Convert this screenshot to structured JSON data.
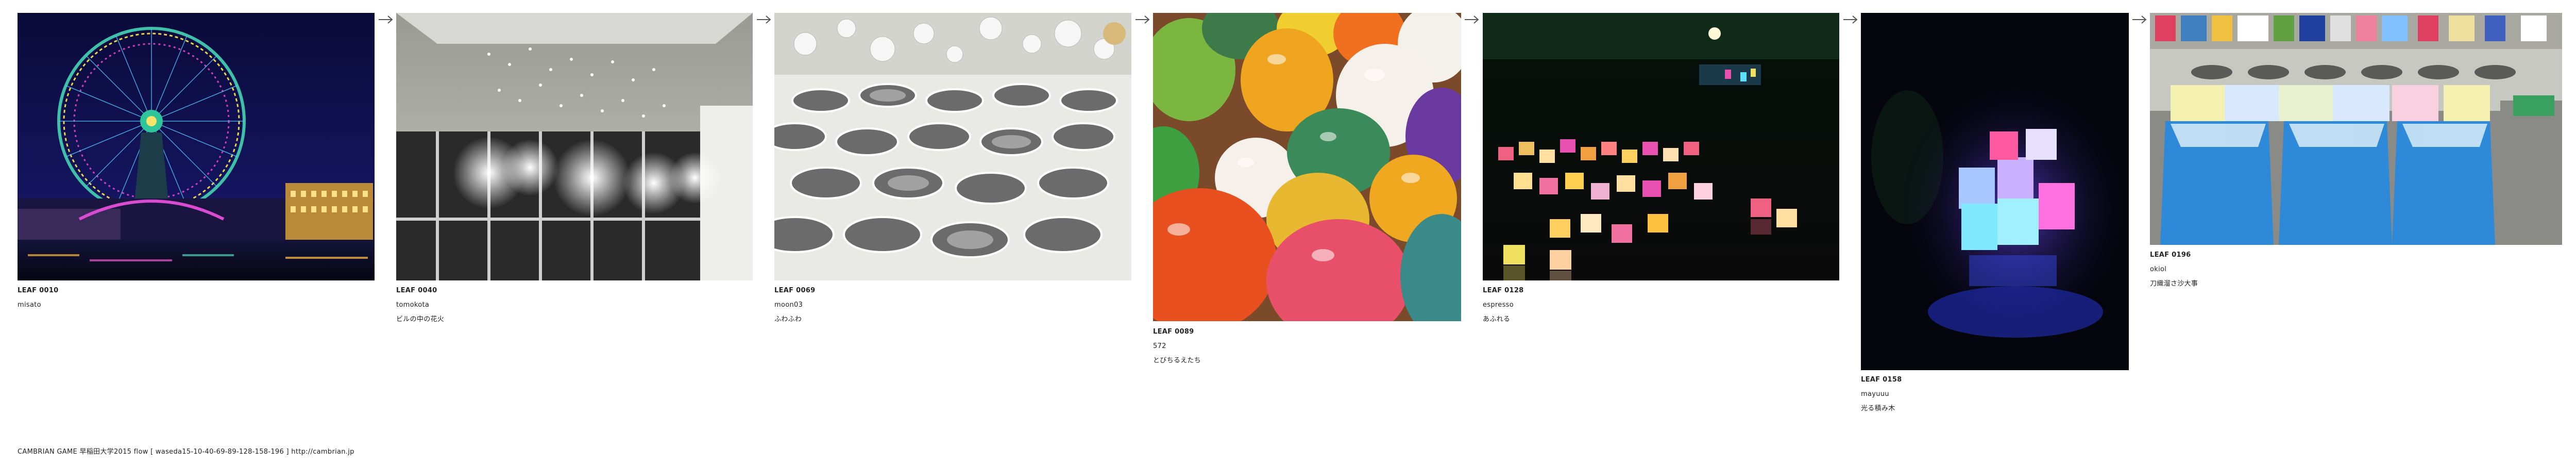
{
  "leaves": [
    {
      "id": "LEAF 0010",
      "author": "misato",
      "title": ""
    },
    {
      "id": "LEAF 0040",
      "author": "tomokota",
      "title": "ビルの中の花火"
    },
    {
      "id": "LEAF 0069",
      "author": "moon03",
      "title": "ふわふわ"
    },
    {
      "id": "LEAF 0089",
      "author": "572",
      "title": "とびちるえたち"
    },
    {
      "id": "LEAF 0128",
      "author": "espresso",
      "title": "あふれる"
    },
    {
      "id": "LEAF 0158",
      "author": "mayuuu",
      "title": "光る積み木"
    },
    {
      "id": "LEAF 0196",
      "author": "okiol",
      "title": "刀織溜さ沙大事"
    }
  ],
  "footer": {
    "text": "CAMBRIAN GAME  早稲田大学2015  flow [ waseda15-10-40-69-89-128-158-196 ]    http://cambrian.jp"
  },
  "icons": {
    "arrow": "arrow-right-icon"
  },
  "colors": {
    "background": "#ffffff",
    "text": "#222222",
    "arrow": "#555555"
  }
}
